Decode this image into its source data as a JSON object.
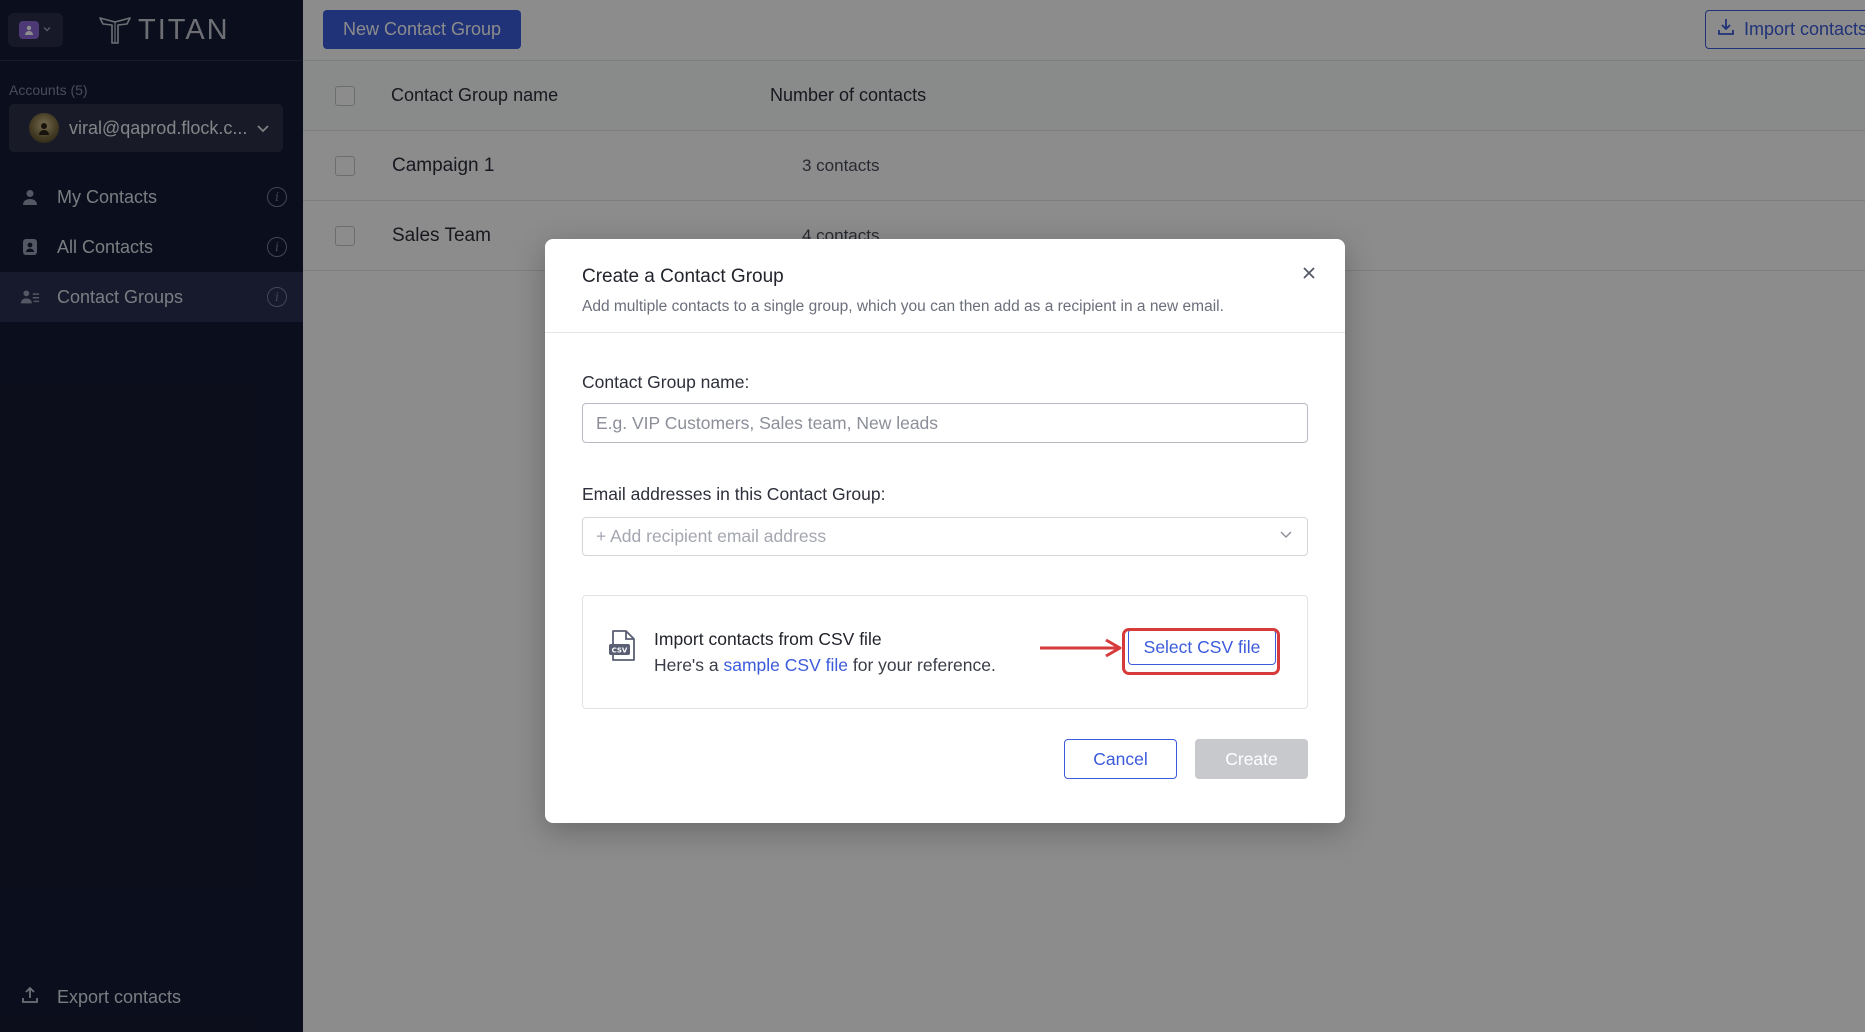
{
  "sidebar": {
    "logo_text": "TITAN",
    "accounts_label": "Accounts (5)",
    "account_email": "viral@qaprod.flock.c...",
    "nav": [
      {
        "label": "My Contacts",
        "icon": "person-icon"
      },
      {
        "label": "All Contacts",
        "icon": "contacts-book-icon"
      },
      {
        "label": "Contact Groups",
        "icon": "contact-groups-icon",
        "active": true
      }
    ],
    "export_label": "Export contacts"
  },
  "toolbar": {
    "new_group_label": "New Contact Group",
    "import_label": "Import contacts"
  },
  "table": {
    "headers": [
      "Contact Group name",
      "Number of contacts"
    ],
    "rows": [
      {
        "name": "Campaign 1",
        "count": "3 contacts"
      },
      {
        "name": "Sales Team",
        "count": "4 contacts"
      }
    ]
  },
  "modal": {
    "title": "Create a Contact Group",
    "subtitle": "Add multiple contacts to a single group, which you can then add as a recipient in a new email.",
    "group_name_label": "Contact Group name:",
    "group_name_placeholder": "E.g. VIP Customers, Sales team, New leads",
    "emails_label": "Email addresses in this Contact Group:",
    "emails_placeholder": "+ Add recipient email address",
    "csv": {
      "icon_text": "CSV",
      "title": "Import contacts from CSV file",
      "desc_prefix": "Here's a ",
      "desc_link": "sample CSV file",
      "desc_suffix": " for your reference.",
      "button": "Select CSV file"
    },
    "cancel_label": "Cancel",
    "create_label": "Create"
  },
  "colors": {
    "sidebar_bg": "#151a33",
    "accent": "#3b5bdb",
    "annotation": "#d63a3a",
    "disabled": "#c8c9cd"
  }
}
